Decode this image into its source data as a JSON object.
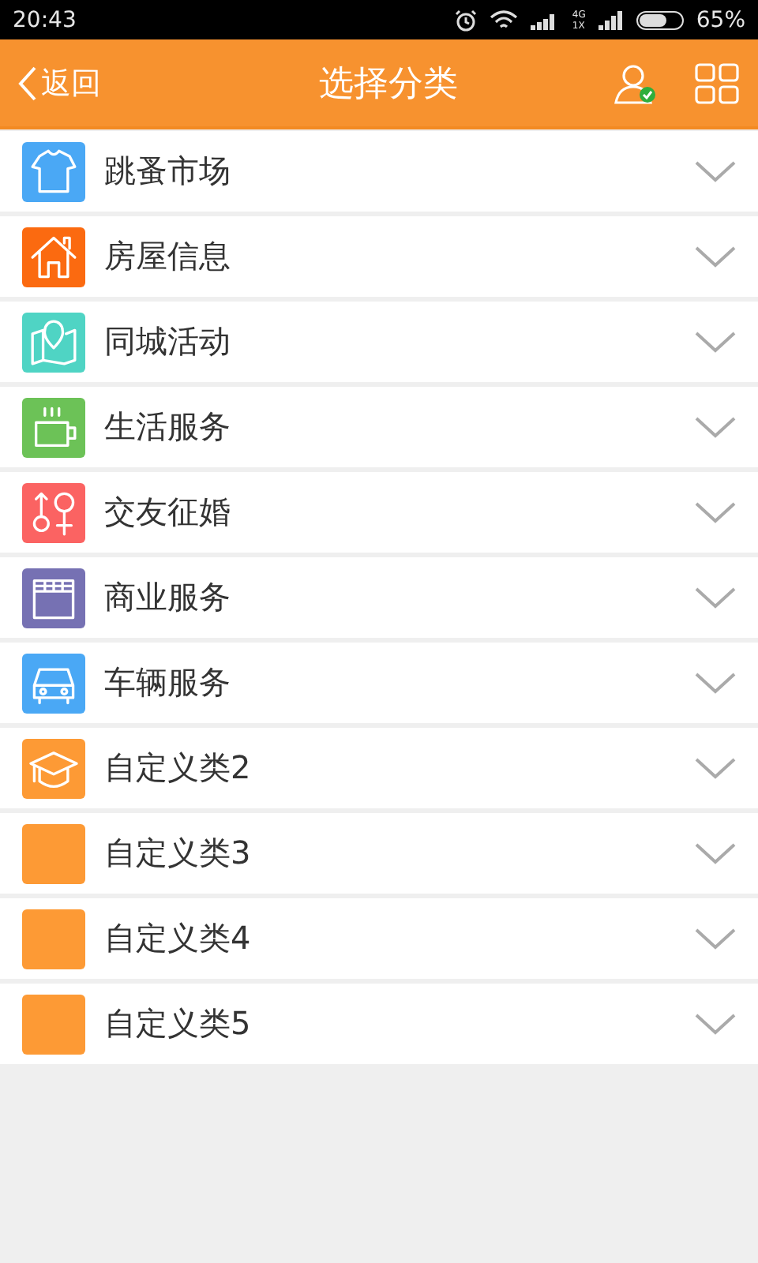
{
  "status_bar": {
    "time": "20:43",
    "network_top": "4G",
    "network_bottom": "1X",
    "battery": "65%"
  },
  "header": {
    "back": "返回",
    "title": "选择分类"
  },
  "categories": [
    {
      "label": "跳蚤市场",
      "kind": "shirt",
      "color": "#4aa8f5"
    },
    {
      "label": "房屋信息",
      "kind": "house",
      "color": "#fb6a10"
    },
    {
      "label": "同城活动",
      "kind": "map",
      "color": "#4fd4c4"
    },
    {
      "label": "生活服务",
      "kind": "cup",
      "color": "#6cc257"
    },
    {
      "label": "交友征婚",
      "kind": "gender",
      "color": "#fb6362"
    },
    {
      "label": "商业服务",
      "kind": "shop",
      "color": "#7671b3"
    },
    {
      "label": "车辆服务",
      "kind": "car",
      "color": "#4aa8f5"
    },
    {
      "label": "自定义类2",
      "kind": "cap",
      "color": "#fd9a35"
    },
    {
      "label": "自定义类3",
      "kind": "plain",
      "color": "#fd9a35"
    },
    {
      "label": "自定义类4",
      "kind": "plain",
      "color": "#fd9a35"
    },
    {
      "label": "自定义类5",
      "kind": "plain",
      "color": "#fd9a35"
    }
  ]
}
